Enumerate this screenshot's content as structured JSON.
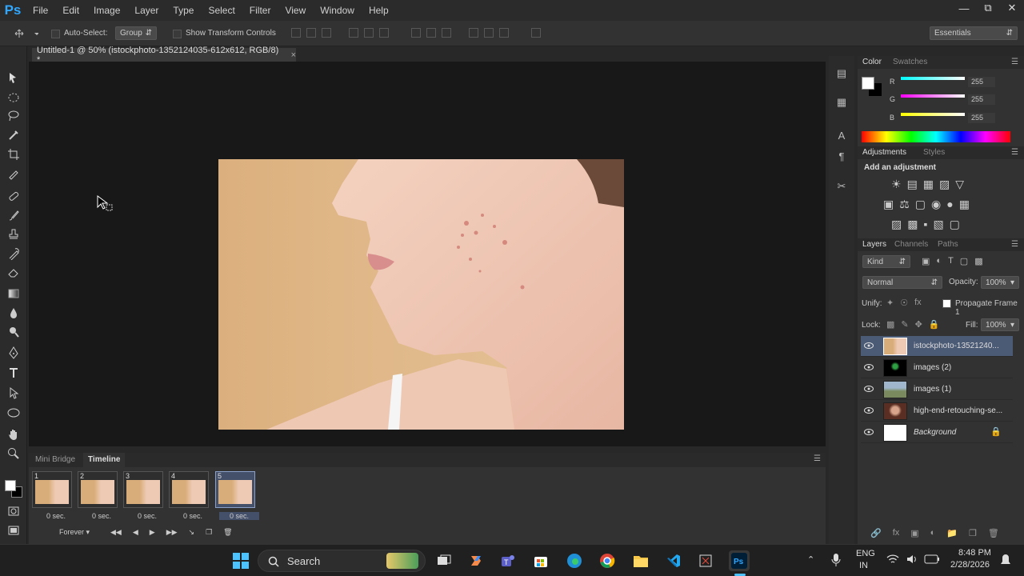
{
  "app": {
    "logo": "Ps"
  },
  "menu": [
    "File",
    "Edit",
    "Image",
    "Layer",
    "Type",
    "Select",
    "Filter",
    "View",
    "Window",
    "Help"
  ],
  "options": {
    "auto_select_label": "Auto-Select:",
    "auto_select_value": "Group",
    "show_transform_label": "Show Transform Controls",
    "workspace": "Essentials"
  },
  "document": {
    "tab_title": "Untitled-1 @ 50% (istockphoto-1352124035-612x612, RGB/8) *",
    "close": "×"
  },
  "timeline": {
    "tabs": [
      "Mini Bridge",
      "Timeline"
    ],
    "frames": [
      {
        "num": "1",
        "delay": "0 sec."
      },
      {
        "num": "2",
        "delay": "0 sec."
      },
      {
        "num": "3",
        "delay": "0 sec."
      },
      {
        "num": "4",
        "delay": "0 sec."
      },
      {
        "num": "5",
        "delay": "0 sec."
      }
    ],
    "loop": "Forever"
  },
  "color_panel": {
    "tabs": [
      "Color",
      "Swatches"
    ],
    "r": "255",
    "g": "255",
    "b": "255",
    "r_label": "R",
    "g_label": "G",
    "b_label": "B"
  },
  "adjustments_panel": {
    "tabs": [
      "Adjustments",
      "Styles"
    ],
    "heading": "Add an adjustment"
  },
  "layers_panel": {
    "tabs": [
      "Layers",
      "Channels",
      "Paths"
    ],
    "kind": "Kind",
    "blend": "Normal",
    "opacity_label": "Opacity:",
    "opacity": "100%",
    "unify_label": "Unify:",
    "propagate_label": "Propagate Frame 1",
    "lock_label": "Lock:",
    "fill_label": "Fill:",
    "fill": "100%",
    "layers": [
      {
        "name": "istockphoto-13521240...",
        "selected": true
      },
      {
        "name": "images (2)"
      },
      {
        "name": "images (1)"
      },
      {
        "name": "high-end-retouching-se..."
      },
      {
        "name": "Background",
        "locked": true
      }
    ]
  },
  "taskbar": {
    "search": "Search",
    "lang1": "ENG",
    "lang2": "IN",
    "time": "8:48 PM",
    "date": "2/28/2026"
  },
  "colors": {
    "accent": "#31a8ff",
    "selected_layer": "#4b5a75",
    "bg_photo": "#dcb27f"
  }
}
